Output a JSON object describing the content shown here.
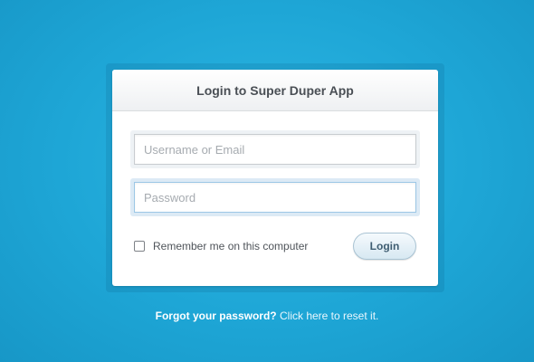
{
  "login": {
    "title": "Login to Super Duper App",
    "username_placeholder": "Username or Email",
    "password_placeholder": "Password",
    "remember_label": "Remember me on this computer",
    "remember_checked": false,
    "login_button": "Login"
  },
  "footer": {
    "forgot_question": "Forgot your password?",
    "reset_link": "Click here to reset it."
  },
  "colors": {
    "background": "#1ea6d6",
    "card": "#ffffff",
    "button_text": "#3f5d72"
  }
}
